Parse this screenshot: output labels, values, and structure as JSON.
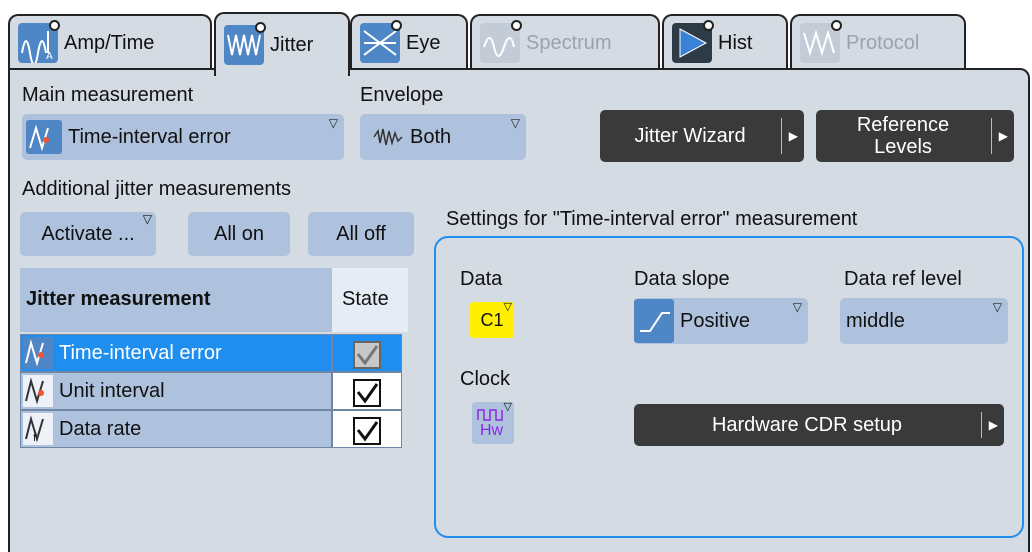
{
  "tabs": [
    {
      "label": "Amp/Time",
      "icon": "amp-time-icon",
      "active": false,
      "disabled": false
    },
    {
      "label": "Jitter",
      "icon": "jitter-icon",
      "active": true,
      "disabled": false
    },
    {
      "label": "Eye",
      "icon": "eye-icon",
      "active": false,
      "disabled": false
    },
    {
      "label": "Spectrum",
      "icon": "spectrum-icon",
      "active": false,
      "disabled": true
    },
    {
      "label": "Hist",
      "icon": "histogram-icon",
      "active": false,
      "disabled": false
    },
    {
      "label": "Protocol",
      "icon": "protocol-icon",
      "active": false,
      "disabled": true
    }
  ],
  "main": {
    "label": "Main measurement",
    "value": "Time-interval error"
  },
  "envelope": {
    "label": "Envelope",
    "value": "Both"
  },
  "buttons": {
    "jitter_wizard": "Jitter Wizard",
    "reference_levels_line1": "Reference",
    "reference_levels_line2": "Levels",
    "activate": "Activate ...",
    "all_on": "All on",
    "all_off": "All off",
    "hardware_cdr": "Hardware CDR setup"
  },
  "additional": {
    "label": "Additional jitter measurements"
  },
  "table": {
    "header_name": "Jitter measurement",
    "header_state": "State",
    "rows": [
      {
        "name": "Time-interval error",
        "checked": true,
        "selected": true
      },
      {
        "name": "Unit interval",
        "checked": true,
        "selected": false
      },
      {
        "name": "Data rate",
        "checked": true,
        "selected": false
      }
    ]
  },
  "settings": {
    "title": "Settings for \"Time-interval error\" measurement",
    "data_label": "Data",
    "data_value": "C1",
    "data_slope_label": "Data slope",
    "data_slope_value": "Positive",
    "data_ref_label": "Data ref level",
    "data_ref_value": "middle",
    "clock_label": "Clock",
    "clock_value": "Hw"
  },
  "colors": {
    "accent": "#1f8eef",
    "panel": "#d4dbe3",
    "control": "#aec2dd",
    "dark_button": "#3a3a3a",
    "c1_yellow": "#ffef00",
    "clock_purple": "#8a2be2"
  }
}
